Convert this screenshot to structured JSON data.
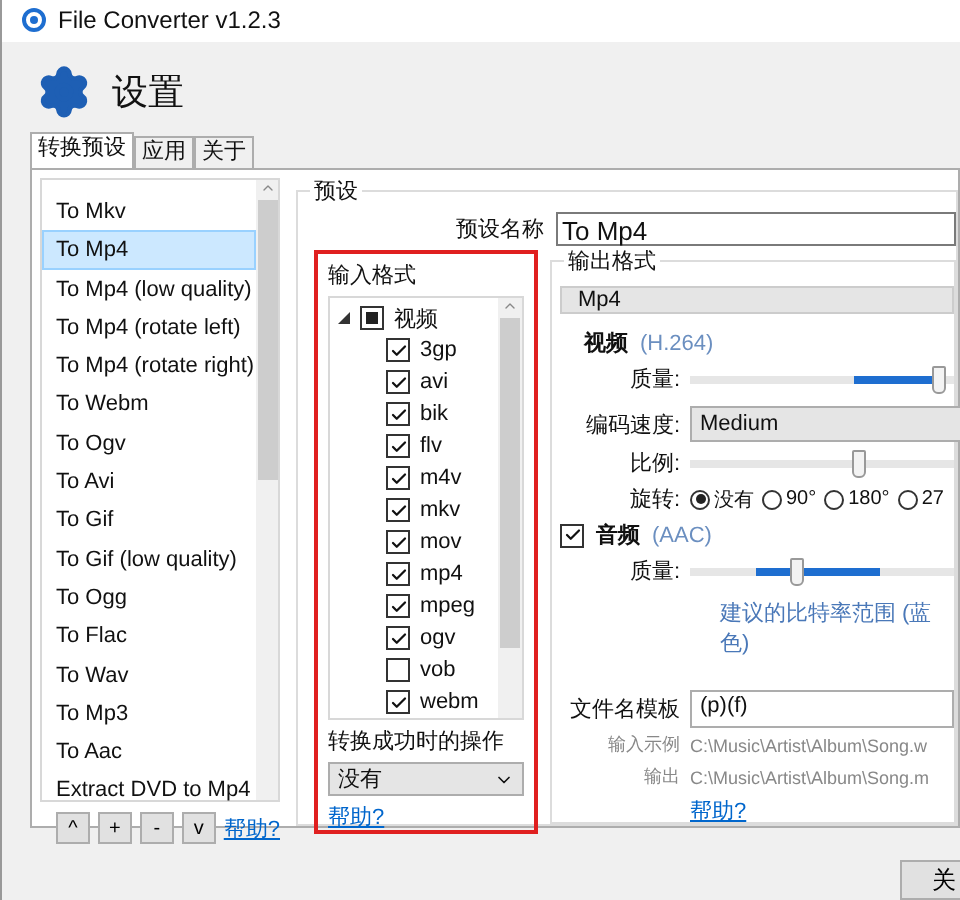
{
  "window": {
    "title": "File Converter v1.2.3"
  },
  "header": {
    "title": "设置"
  },
  "tabs": [
    {
      "label": "转换预设",
      "selected": true
    },
    {
      "label": "应用",
      "selected": false
    },
    {
      "label": "关于",
      "selected": false
    }
  ],
  "presets": {
    "items": [
      {
        "label": "To Mkv",
        "selected": false
      },
      {
        "label": "To Mp4",
        "selected": true
      },
      {
        "label": "To Mp4 (low quality)",
        "selected": false
      },
      {
        "label": "To Mp4 (rotate left)",
        "selected": false
      },
      {
        "label": "To Mp4 (rotate right)",
        "selected": false
      },
      {
        "label": "To Webm",
        "selected": false
      },
      {
        "label": "To Ogv",
        "selected": false
      },
      {
        "label": "To Avi",
        "selected": false
      },
      {
        "label": "To Gif",
        "selected": false
      },
      {
        "label": "To Gif (low quality)",
        "selected": false
      },
      {
        "label": "To Ogg",
        "selected": false
      },
      {
        "label": "To Flac",
        "selected": false
      },
      {
        "label": "To Wav",
        "selected": false
      },
      {
        "label": "To Mp3",
        "selected": false
      },
      {
        "label": "To Aac",
        "selected": false
      },
      {
        "label": "Extract DVD to Mp4",
        "selected": false
      }
    ],
    "buttons": [
      "^",
      "+",
      "-",
      "v"
    ],
    "help_link": "帮助?"
  },
  "preset": {
    "title": "预设",
    "name_label": "预设名称",
    "name_value": "To Mp4",
    "input_formats": {
      "title": "输入格式",
      "category": {
        "label": "视频",
        "expanded": true,
        "indeterminate": true
      },
      "formats": [
        {
          "label": "3gp",
          "checked": true
        },
        {
          "label": "avi",
          "checked": true
        },
        {
          "label": "bik",
          "checked": true
        },
        {
          "label": "flv",
          "checked": true
        },
        {
          "label": "m4v",
          "checked": true
        },
        {
          "label": "mkv",
          "checked": true
        },
        {
          "label": "mov",
          "checked": true
        },
        {
          "label": "mp4",
          "checked": true
        },
        {
          "label": "mpeg",
          "checked": true
        },
        {
          "label": "ogv",
          "checked": true
        },
        {
          "label": "vob",
          "checked": false
        },
        {
          "label": "webm",
          "checked": true
        }
      ],
      "on_success_label": "转换成功时的操作",
      "on_success_value": "没有",
      "help_link": "帮助?"
    },
    "output": {
      "title": "输出格式",
      "format": "Mp4",
      "video": {
        "label": "视频",
        "codec": "(H.264)",
        "quality_label": "质量:",
        "quality": {
          "level": 0.97
        },
        "speed_label": "编码速度:",
        "speed": "Medium",
        "scale_label": "比例:",
        "scale": {
          "level": 0.65
        },
        "rotate_label": "旋转:",
        "rotations": [
          {
            "label": "没有",
            "selected": true
          },
          {
            "label": "90°",
            "selected": false
          },
          {
            "label": "180°",
            "selected": false
          },
          {
            "label": "27",
            "selected": false
          }
        ]
      },
      "audio": {
        "label": "音频",
        "enabled": true,
        "codec": "(AAC)",
        "quality_label": "质量:",
        "quality": {
          "level": 0.4
        },
        "hint": "建议的比特率范围 (蓝色)"
      },
      "filename": {
        "label": "文件名模板",
        "value": "(p)(f)",
        "input_label": "输入示例",
        "input_example": "C:\\Music\\Artist\\Album\\Song.w",
        "output_label": "输出",
        "output_example": "C:\\Music\\Artist\\Album\\Song.m",
        "help_link": "帮助?"
      }
    }
  },
  "footer": {
    "button": "关"
  }
}
